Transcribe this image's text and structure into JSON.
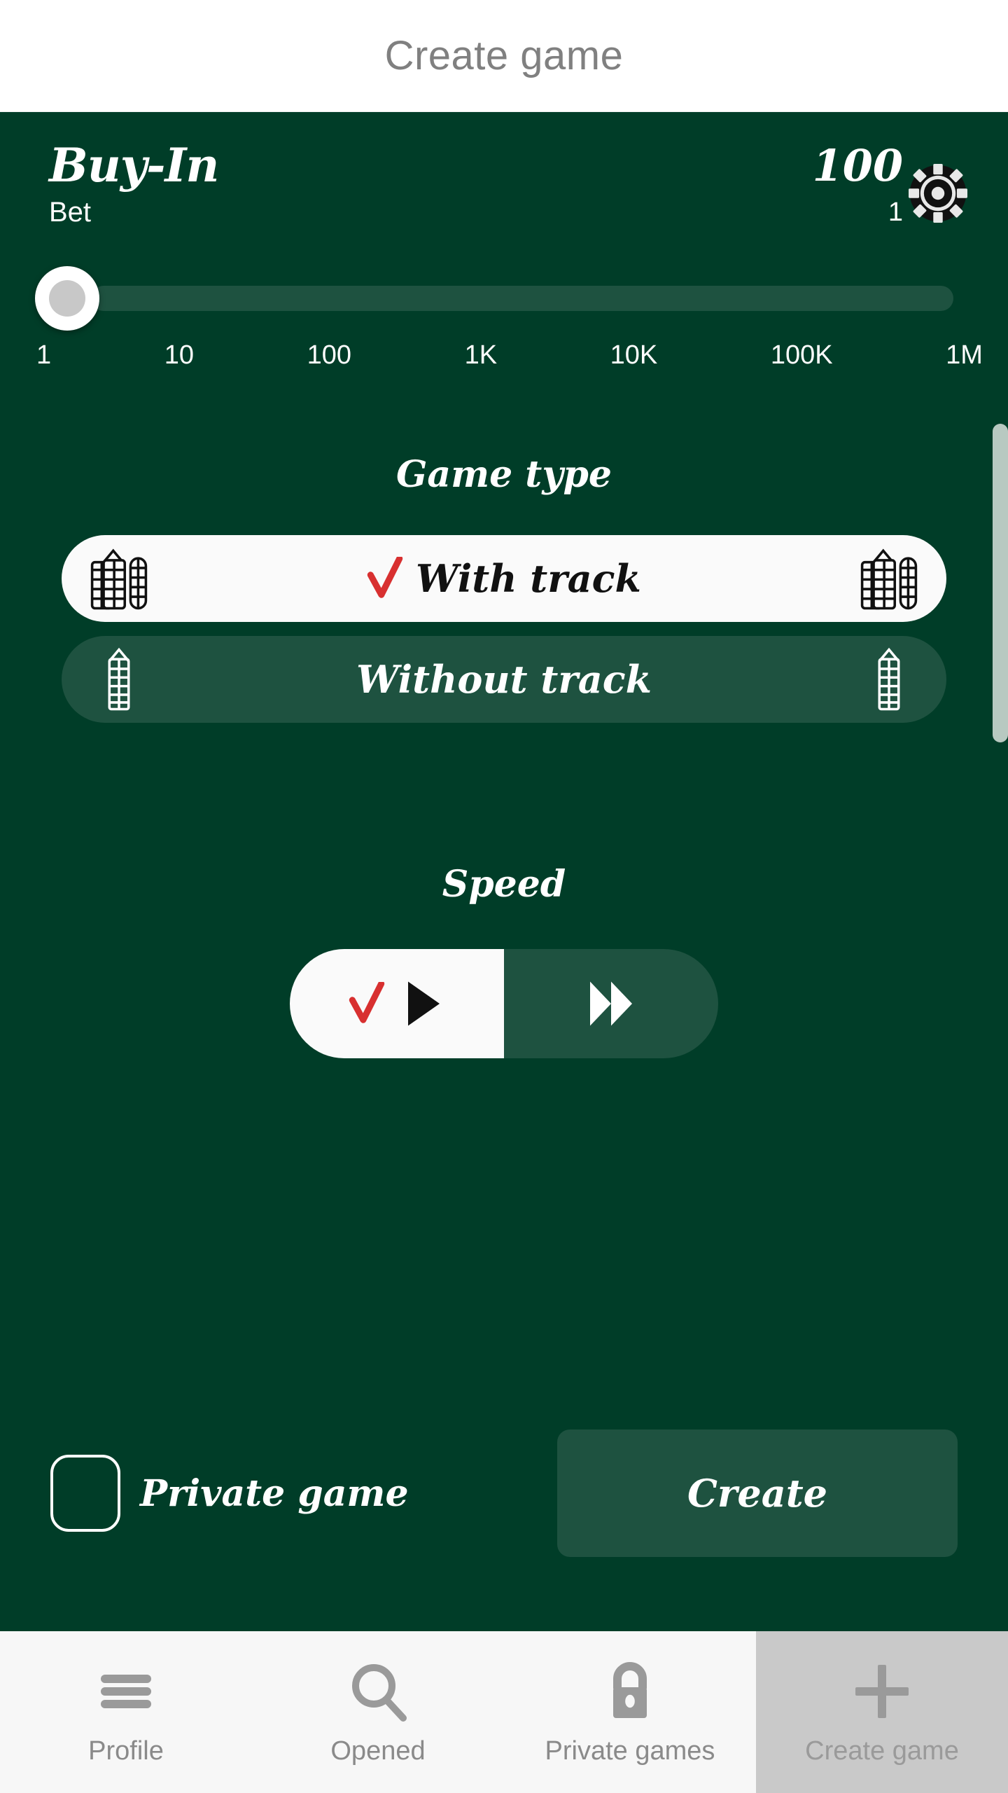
{
  "header": {
    "title": "Create game"
  },
  "buyin": {
    "title": "Buy-In",
    "subtitle": "Bet",
    "amount": "100",
    "multiplier": "1",
    "chip_icon": "chip-gear-icon",
    "slider": {
      "value_index": 0,
      "ticks": [
        "1",
        "10",
        "100",
        "1K",
        "10K",
        "100K",
        "1M"
      ]
    }
  },
  "game_type": {
    "heading": "Game type",
    "options": [
      {
        "label": "With track",
        "selected": true,
        "icon": "double-domino-icon"
      },
      {
        "label": "Without track",
        "selected": false,
        "icon": "single-domino-icon"
      }
    ]
  },
  "speed": {
    "heading": "Speed",
    "options": [
      {
        "name": "normal-speed",
        "icon": "play-icon",
        "selected": true
      },
      {
        "name": "fast-speed",
        "icon": "fast-forward-icon",
        "selected": false
      }
    ]
  },
  "footer": {
    "private_game_label": "Private game",
    "private_game_checked": false,
    "create_label": "Create"
  },
  "navbar": {
    "items": [
      {
        "label": "Profile",
        "icon": "menu-icon",
        "active": false
      },
      {
        "label": "Opened",
        "icon": "search-icon",
        "active": false
      },
      {
        "label": "Private games",
        "icon": "lock-icon",
        "active": false
      },
      {
        "label": "Create game",
        "icon": "plus-icon",
        "active": true
      }
    ]
  },
  "colors": {
    "background_green": "#003d28",
    "panel_green": "#1e5240",
    "accent_red": "#d83030",
    "header_text": "#808080",
    "nav_icon": "#9a9a9a",
    "nav_active_bg": "#c9c9c9",
    "scrollbar": "#b8c9c1"
  }
}
